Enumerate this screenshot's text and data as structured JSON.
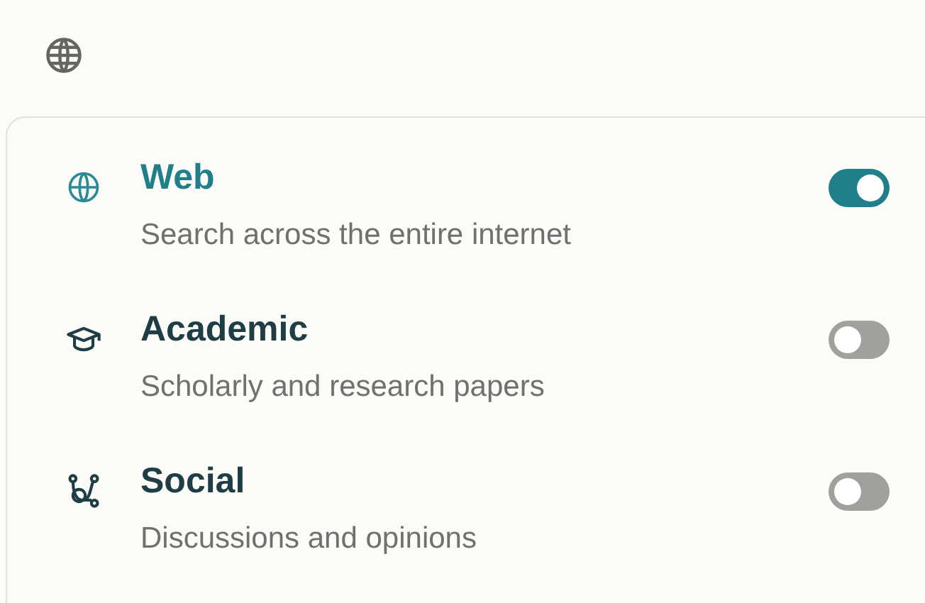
{
  "sources": [
    {
      "kind": "web",
      "title": "Web",
      "description": "Search across the entire internet",
      "on": true
    },
    {
      "kind": "academic",
      "title": "Academic",
      "description": "Scholarly and research papers",
      "on": false
    },
    {
      "kind": "social",
      "title": "Social",
      "description": "Discussions and opinions",
      "on": false
    }
  ]
}
